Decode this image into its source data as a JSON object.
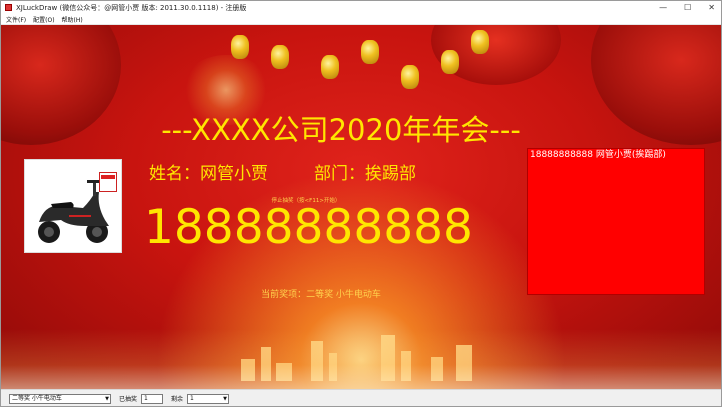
{
  "window": {
    "title": "XJLuckDraw (微信公众号：@网管小贾 版本: 2011.30.0.1118) - 注册版",
    "controls": {
      "minimize": "—",
      "maximize": "☐",
      "close": "✕"
    }
  },
  "menu": {
    "items": [
      "文件(F)",
      "配置(O)",
      "帮助(H)"
    ]
  },
  "event": {
    "title": "---XXXX公司2020年年会---"
  },
  "current": {
    "name_label": "姓名：网管小贾",
    "dept_label": "部门：挨踢部",
    "hint": "停止抽奖（按<F11>开始）",
    "number": "18888888888",
    "prize_line": "当前奖项：二等奖 小牛电动车"
  },
  "winners": {
    "items": [
      "18888888888 网管小贾(挨踢部)"
    ]
  },
  "bottom": {
    "prize_select": "二等奖 小牛电动车",
    "drawn_label": "已抽奖",
    "drawn_value": "1",
    "remain_label": "剩余",
    "remain_select": "1"
  },
  "colors": {
    "accent": "#ffe600",
    "background": "#c8140f",
    "winners_bg": "#ff0000"
  },
  "icons": {
    "app": "app-icon",
    "prize": "scooter-image"
  }
}
